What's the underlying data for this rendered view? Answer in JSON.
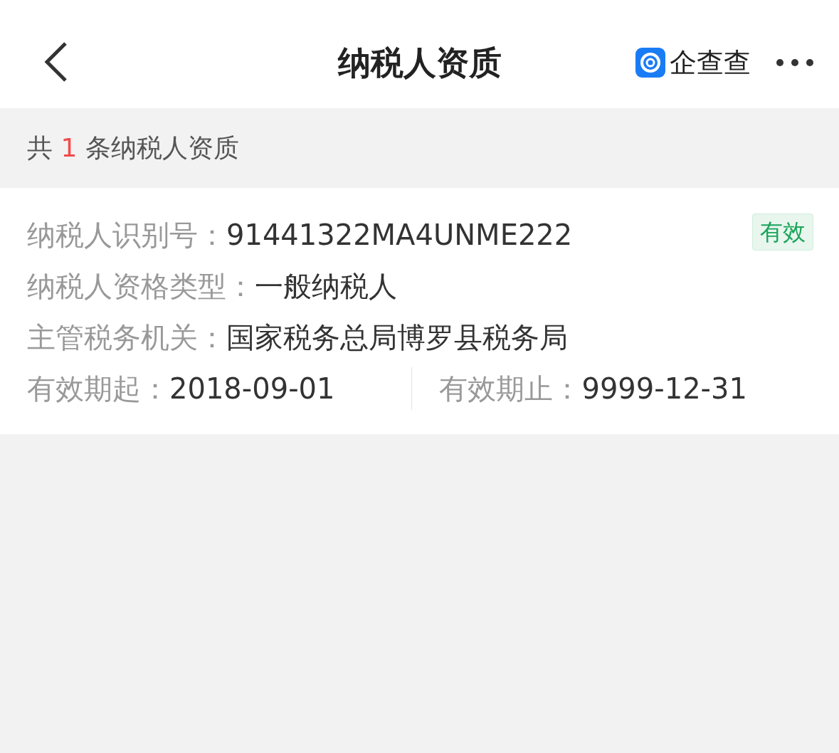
{
  "header": {
    "title": "纳税人资质",
    "brand": "企查查"
  },
  "summary": {
    "prefix": "共",
    "count": "1",
    "suffix": "条纳税人资质"
  },
  "record": {
    "status": "有效",
    "rows": [
      [
        {
          "label": "纳税人识别号：",
          "value": "91441322MA4UNME222"
        }
      ],
      [
        {
          "label": "纳税人资格类型：",
          "value": "一般纳税人"
        }
      ],
      [
        {
          "label": "主管税务机关：",
          "value": "国家税务总局博罗县税务局"
        }
      ],
      [
        {
          "label": "有效期起：",
          "value": "2018-09-01"
        },
        {
          "label": "有效期止：",
          "value": "9999-12-31"
        }
      ]
    ]
  }
}
